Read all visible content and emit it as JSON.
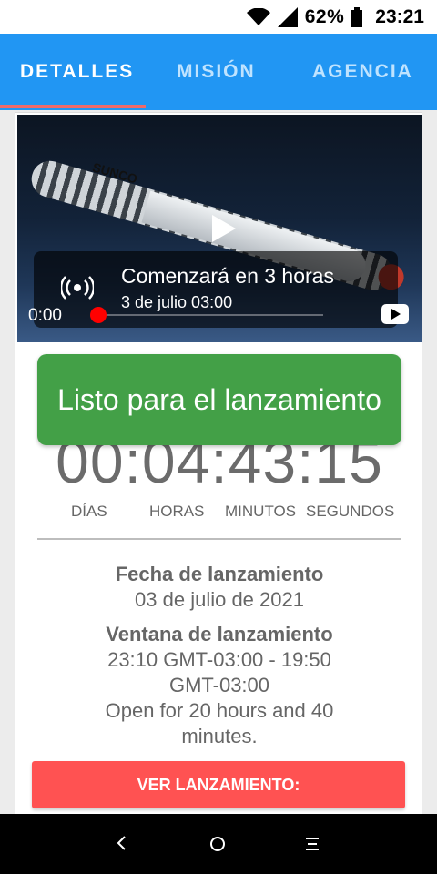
{
  "statusbar": {
    "battery_percent": "62%",
    "time": "23:21"
  },
  "tabs": [
    {
      "label": "DETALLES",
      "active": true
    },
    {
      "label": "MISIÓN",
      "active": false
    },
    {
      "label": "AGENCIA",
      "active": false
    }
  ],
  "video": {
    "title": "Comenzará en 3 horas",
    "date": "3 de julio 03:00",
    "current_time": "0:00",
    "rocket_text": "SUNCO"
  },
  "status_button": {
    "label": "Listo para el lanzamiento"
  },
  "countdown": {
    "value": "00:04:43:15",
    "units": [
      "DÍAS",
      "HORAS",
      "MINUTOS",
      "SEGUNDOS"
    ]
  },
  "launch": {
    "date_label": "Fecha de lanzamiento",
    "date_value": "03 de julio de 2021",
    "window_label": "Ventana de lanzamiento",
    "window_line1": "23:10 GMT-03:00 - 19:50",
    "window_line2": "GMT-03:00",
    "open_line1": "Open for 20 hours and 40",
    "open_line2": "minutes."
  },
  "watch_button": {
    "label": "VER LANZAMIENTO:"
  },
  "colors": {
    "tabbar": "#2196f3",
    "status_green": "#43a047",
    "watch_red": "#ff5252"
  }
}
